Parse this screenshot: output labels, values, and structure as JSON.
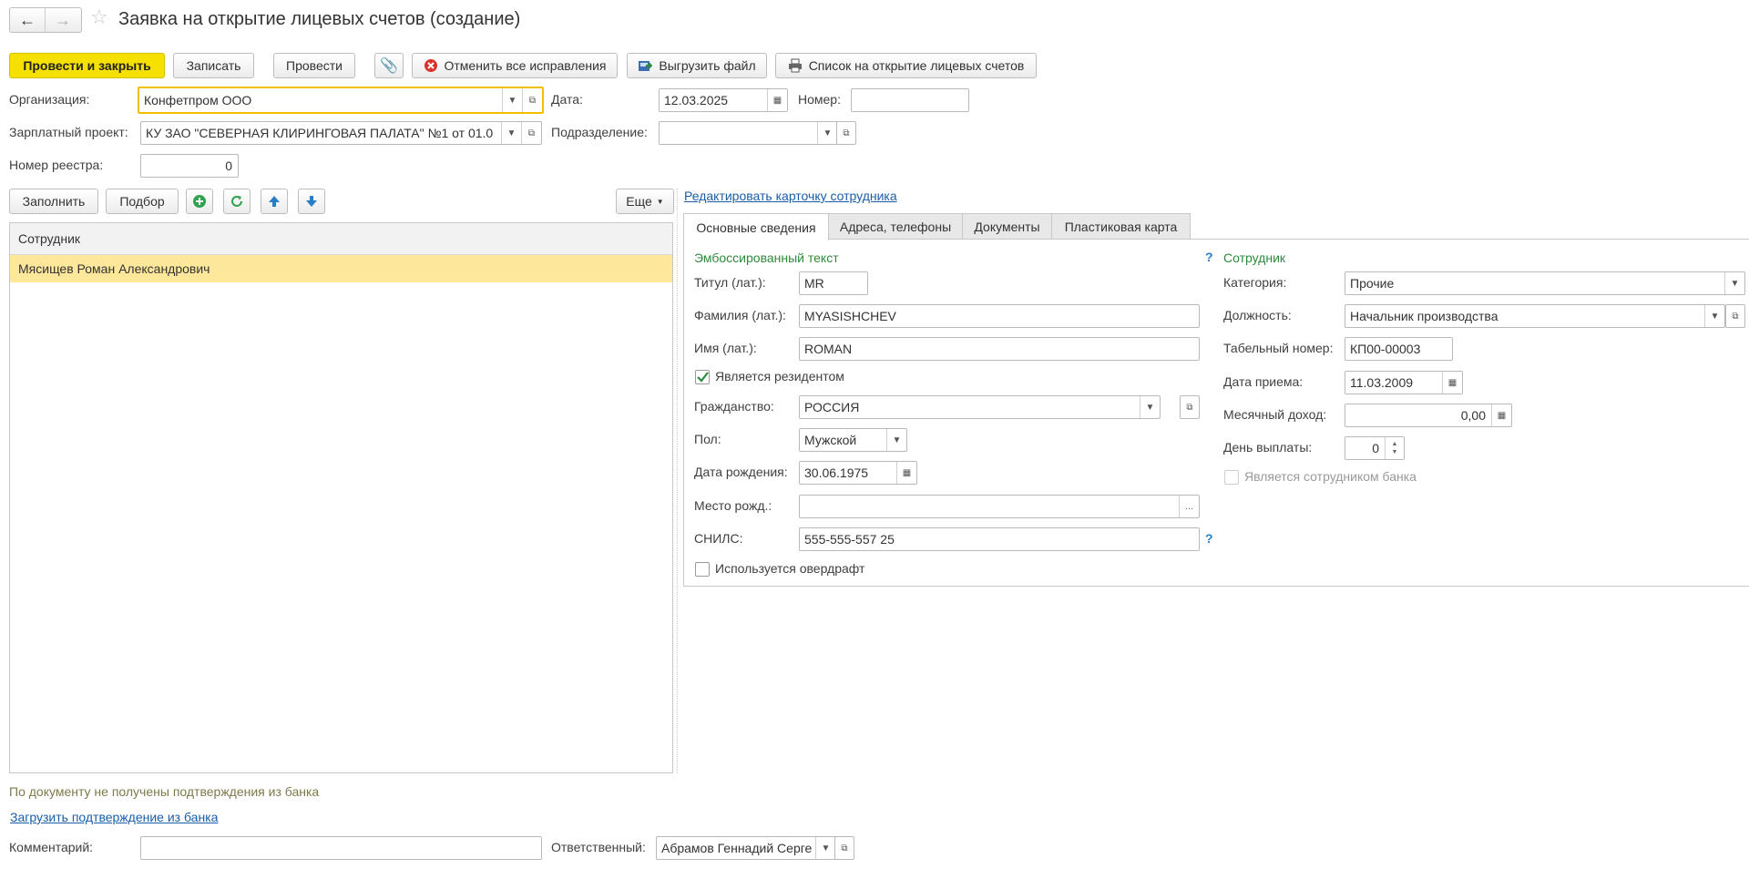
{
  "window": {
    "title": "Заявка на открытие лицевых счетов (создание)"
  },
  "toolbar": {
    "post_close": "Провести и закрыть",
    "save": "Записать",
    "post": "Провести",
    "cancel_fixes": "Отменить все исправления",
    "export_file": "Выгрузить файл",
    "list_accounts": "Список на открытие лицевых счетов"
  },
  "header": {
    "org_label": "Организация:",
    "org_value": "Конфетпром ООО",
    "date_label": "Дата:",
    "date_value": "12.03.2025",
    "number_label": "Номер:",
    "number_value": "",
    "salary_label": "Зарплатный проект:",
    "salary_value": "КУ ЗАО \"СЕВЕРНАЯ КЛИРИНГОВАЯ ПАЛАТА\" №1 от 01.0",
    "division_label": "Подразделение:",
    "division_value": "",
    "registry_label": "Номер реестра:",
    "registry_value": "0"
  },
  "list": {
    "fill": "Заполнить",
    "select": "Подбор",
    "more": "Еще",
    "column": "Сотрудник",
    "rows": [
      "Мясищев Роман Александрович"
    ]
  },
  "edit_card_link": "Редактировать карточку сотрудника",
  "tabs": [
    "Основные сведения",
    "Адреса, телефоны",
    "Документы",
    "Пластиковая карта"
  ],
  "emboss": {
    "section": "Эмбоссированный текст",
    "title_label": "Титул (лат.):",
    "title_value": "MR",
    "surname_label": "Фамилия (лат.):",
    "surname_value": "MYASISHCHEV",
    "name_label": "Имя (лат.):",
    "name_value": "ROMAN",
    "resident_label": "Является резидентом",
    "resident_checked": true,
    "citizenship_label": "Гражданство:",
    "citizenship_value": "РОССИЯ",
    "sex_label": "Пол:",
    "sex_value": "Мужской",
    "birth_label": "Дата рождения:",
    "birth_value": "30.06.1975",
    "birthplace_label": "Место рожд.:",
    "birthplace_value": "",
    "snils_label": "СНИЛС:",
    "snils_value": "555-555-557 25",
    "overdraft_label": "Используется овердрафт",
    "overdraft_checked": false
  },
  "employee": {
    "section": "Сотрудник",
    "category_label": "Категория:",
    "category_value": "Прочие",
    "position_label": "Должность:",
    "position_value": "Начальник производства",
    "tabnum_label": "Табельный номер:",
    "tabnum_value": "КП00-00003",
    "hire_label": "Дата приема:",
    "hire_value": "11.03.2009",
    "income_label": "Месячный доход:",
    "income_value": "0,00",
    "payday_label": "День выплаты:",
    "payday_value": "0",
    "bank_employee_label": "Является сотрудником банка",
    "bank_employee_checked": false
  },
  "footer": {
    "status_text": "По документу не получены подтверждения из банка",
    "load_link": "Загрузить подтверждение из банка",
    "comment_label": "Комментарий:",
    "comment_value": "",
    "responsible_label": "Ответственный:",
    "responsible_value": "Абрамов Геннадий Серге"
  },
  "colors": {
    "accent_yellow": "#f5e000",
    "selected_row": "#fde79a",
    "link_blue": "#1a5ea8",
    "section_green": "#2c8a3c"
  }
}
